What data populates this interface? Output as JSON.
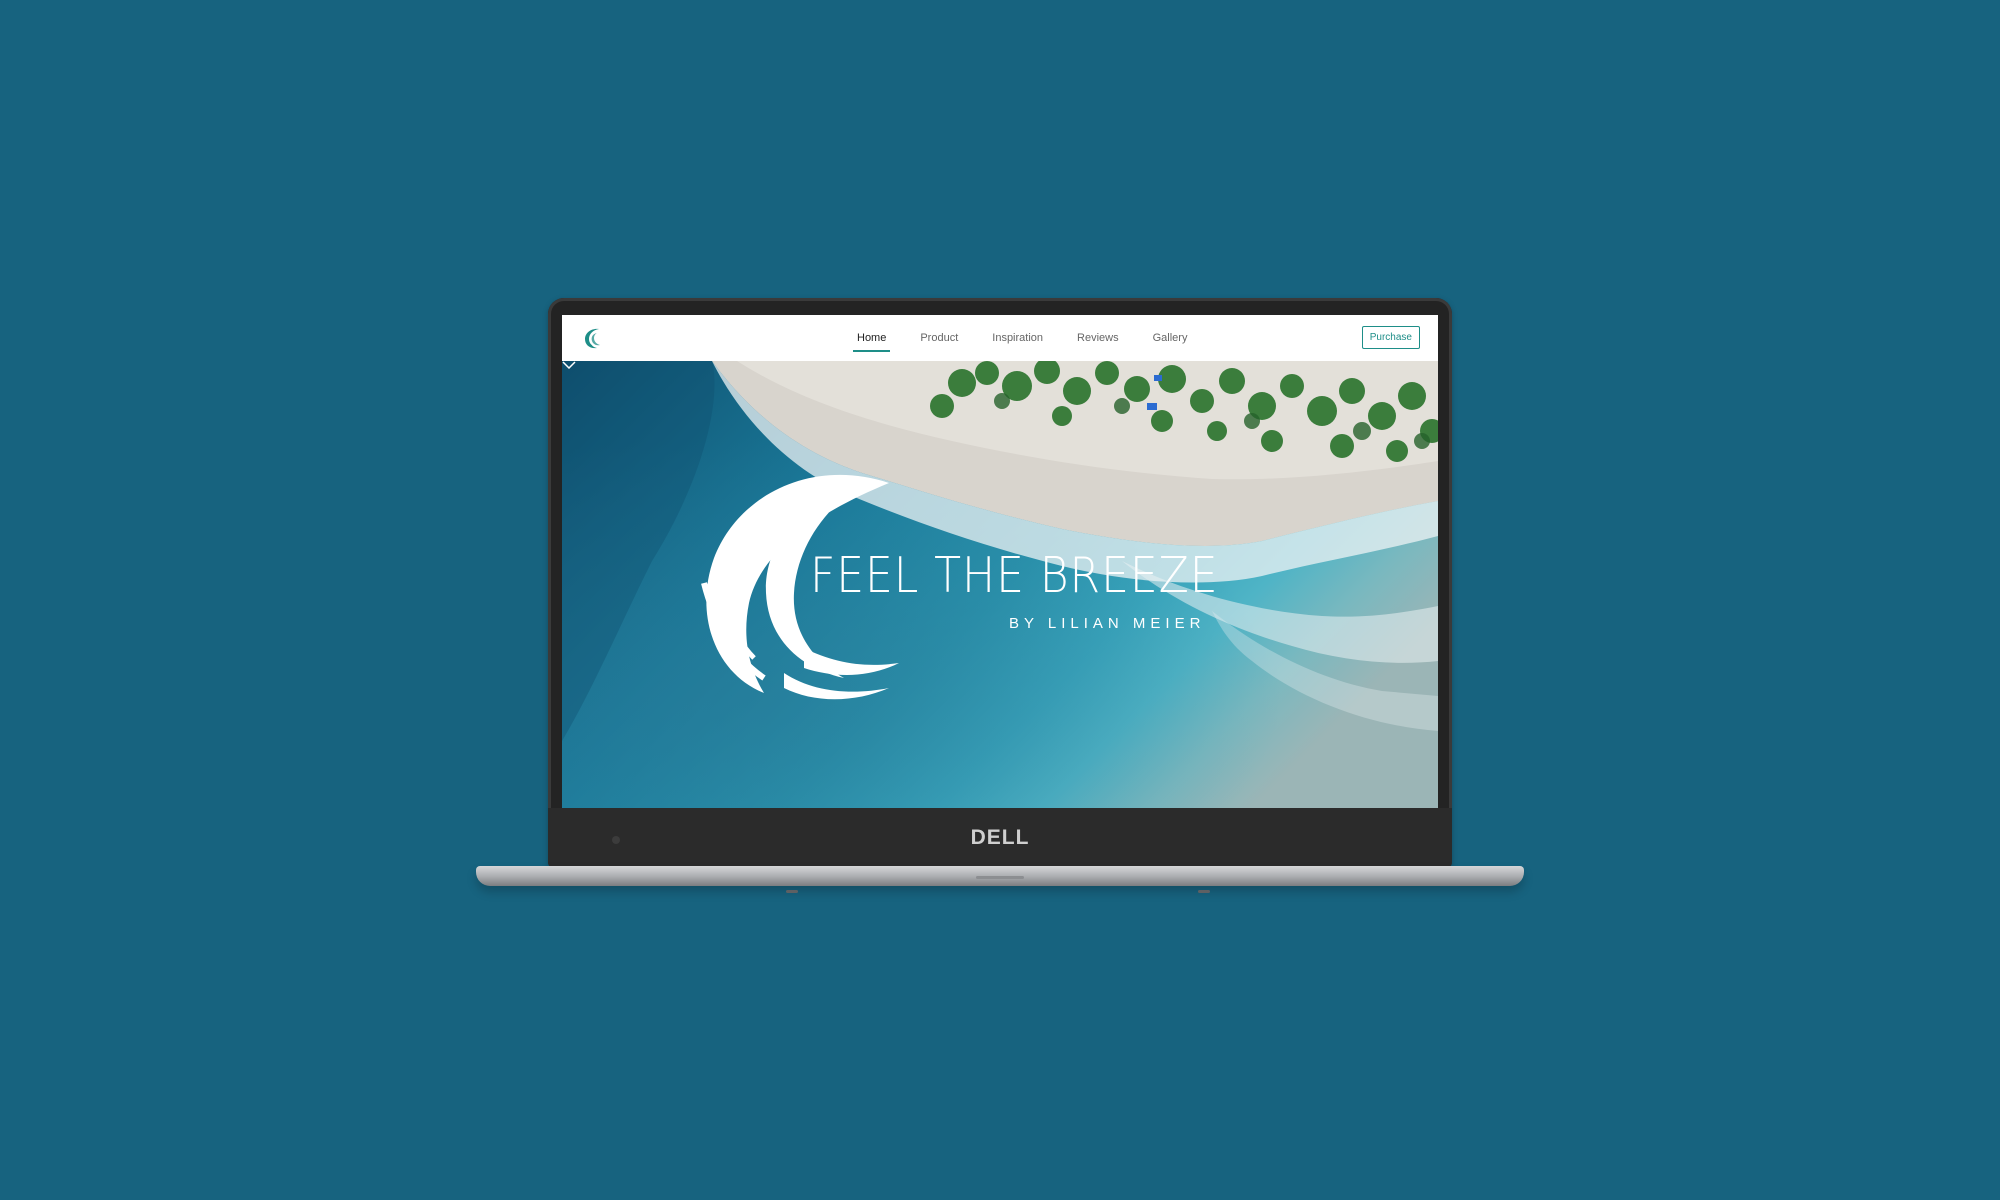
{
  "nav": {
    "links": [
      {
        "label": "Home",
        "active": true
      },
      {
        "label": "Product",
        "active": false
      },
      {
        "label": "Inspiration",
        "active": false
      },
      {
        "label": "Reviews",
        "active": false
      },
      {
        "label": "Gallery",
        "active": false
      }
    ],
    "purchase_label": "Purchase"
  },
  "hero": {
    "title": "FEEL THE BREEZE",
    "subtitle": "BY LILIAN MEIER"
  },
  "device": {
    "brand": "DELL"
  },
  "colors": {
    "background": "#17637f",
    "accent": "#1e8e88",
    "nav_text": "#666666",
    "nav_active_text": "#222222"
  },
  "icons": {
    "logo": "wave-logo-icon",
    "hero_logo": "wave-emblem-icon",
    "scroll": "chevron-down-icon"
  }
}
